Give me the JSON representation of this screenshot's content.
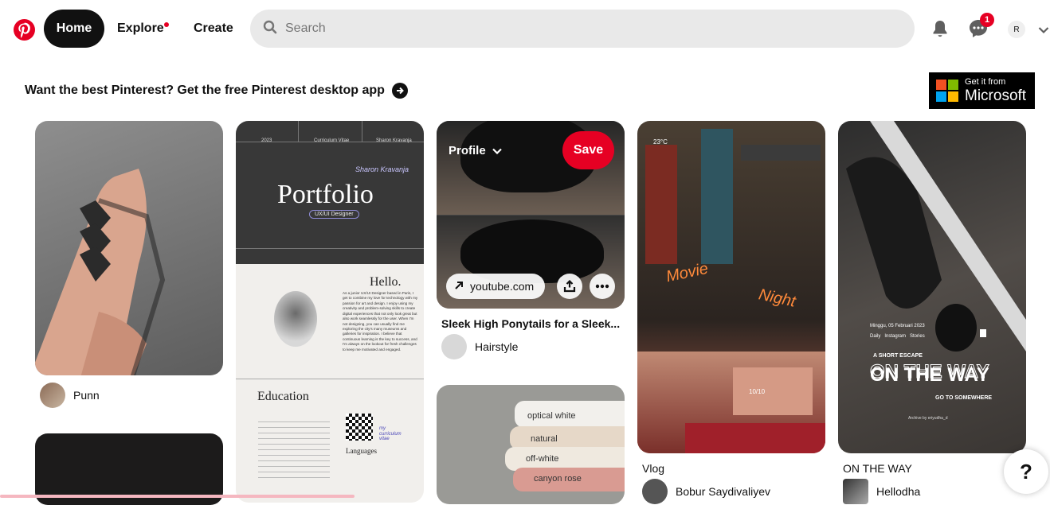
{
  "nav": {
    "home": "Home",
    "explore": "Explore",
    "create": "Create"
  },
  "search": {
    "placeholder": "Search"
  },
  "header": {
    "messages_count": "1",
    "avatar_initial": "R"
  },
  "promo": {
    "text": "Want the best Pinterest? Get the free Pinterest desktop app"
  },
  "ms_badge": {
    "line1": "Get it from",
    "line2": "Microsoft"
  },
  "colors": {
    "brand": "#e60023",
    "dark": "#111111",
    "search_bg": "#e9e9e9"
  },
  "pins": {
    "tattoo": {
      "user": "Punn"
    },
    "portfolio": {
      "header_year": "2023",
      "header_label": "Curriculum Vitae",
      "header_name": "Sharon Kravanja",
      "title": "Portfolio",
      "role": "UX/UI Designer",
      "signature": "Sharon Kravanja",
      "hello": "Hello.",
      "bio": "As a junior UX/UI Designer based in Paris, I get to combine my love for technology with my passion for art and design. I enjoy using my creativity and problem-solving skills to create digital experiences that not only look great but also work seamlessly for the user. When I'm not designing, you can usually find me exploring the city's many museums and galleries for inspiration. I believe that continuous learning is the key to success, and I'm always on the lookout for fresh challenges to keep me motivated and engaged.",
      "education": "Education",
      "languages": "Languages",
      "curriculum_note": "my curriculum vitae"
    },
    "haircut": {
      "board": "Profile",
      "save": "Save",
      "link": "youtube.com",
      "title": "Sleek High Ponytails for a Sleek...",
      "user": "Hairstyle"
    },
    "towels": {
      "labels": [
        "optical white",
        "natural",
        "off-white",
        "canyon rose"
      ]
    },
    "vlog": {
      "temperature": "23°C",
      "movie": "Movie",
      "night": "Night",
      "counter": "10/10",
      "title": "Vlog",
      "user": "Bobur Saydivaliyev"
    },
    "ontheway": {
      "date": "Minggu, 05 Februari 2023",
      "tabs": "Daily   Instagram   Stories",
      "escape": "A SHORT ESCAPE",
      "headline": "ON THE WAY",
      "sub": "GO TO SOMEWHERE",
      "archive": "Archive by eriyudha_d",
      "title": "ON THE WAY",
      "user": "Hellodha"
    }
  },
  "help": {
    "label": "?"
  }
}
